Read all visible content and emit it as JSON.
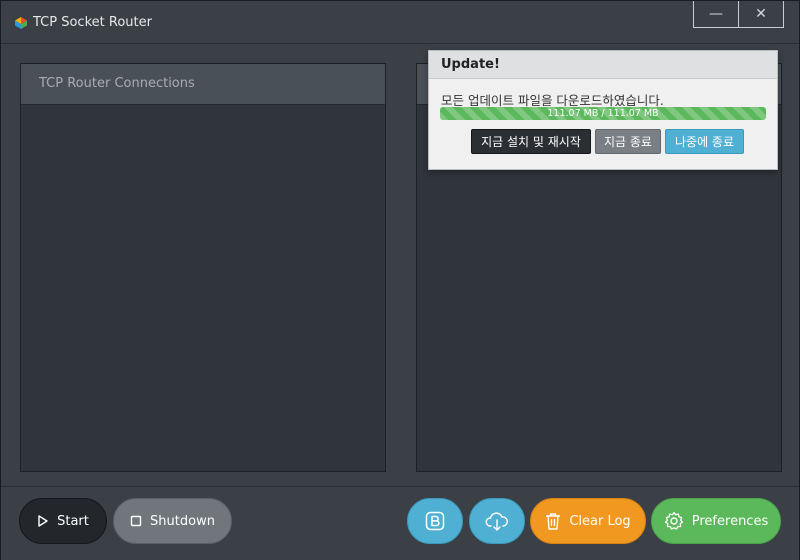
{
  "window": {
    "title": "TCP Socket Router",
    "minimize_glyph": "—",
    "close_glyph": "✕"
  },
  "left_panel": {
    "title": "TCP Router Connections"
  },
  "right_panel": {
    "title": ""
  },
  "update_popup": {
    "title": "Update!",
    "message": "모든 업데이트 파일을 다운로드하였습니다.",
    "progress_text": "111.07 MB / 111.07 MB",
    "progress_fraction": 1.0,
    "install_label": "지금 설치 및 재시작",
    "quit_label": "지금 종료",
    "later_label": "나중에 종료"
  },
  "toolbar": {
    "start_label": "Start",
    "shutdown_label": "Shutdown",
    "clear_log_label": "Clear Log",
    "preferences_label": "Preferences",
    "icons": [
      "play-icon",
      "stop-icon",
      "bootstrap-icon",
      "cloud-download-icon",
      "trash-icon",
      "gear-icon"
    ]
  },
  "colors": {
    "accent_blue": "#4fb0d3",
    "accent_orange": "#f0981f",
    "accent_green": "#5bb95b",
    "progress_green": "#5cb85c"
  }
}
